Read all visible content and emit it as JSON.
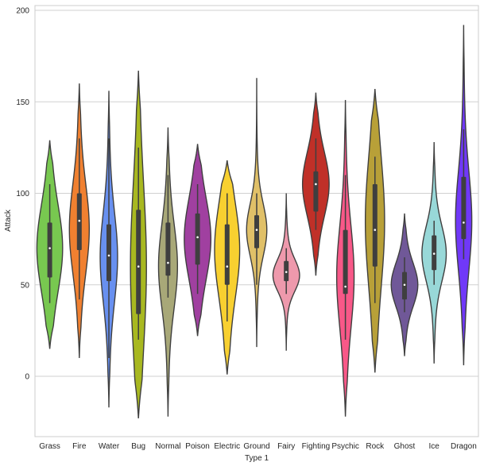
{
  "chart_data": {
    "type": "violin",
    "title": "",
    "xlabel": "Type 1",
    "ylabel": "Attack",
    "ylim": [
      -32,
      202
    ],
    "yticks": [
      0,
      50,
      100,
      150,
      200
    ],
    "grid": true,
    "categories": [
      "Grass",
      "Fire",
      "Water",
      "Bug",
      "Normal",
      "Poison",
      "Electric",
      "Ground",
      "Fairy",
      "Fighting",
      "Psychic",
      "Rock",
      "Ghost",
      "Ice",
      "Dragon"
    ],
    "colors": [
      "#78c850",
      "#f08030",
      "#6890f0",
      "#a8b820",
      "#a8a878",
      "#a040a0",
      "#f8d030",
      "#e0c068",
      "#ee99ac",
      "#c03028",
      "#f85888",
      "#b8a038",
      "#705898",
      "#98d8d8",
      "#7038f8"
    ],
    "series": [
      {
        "name": "Grass",
        "kde_min": 15,
        "kde_max": 129,
        "whisker_low": 40,
        "q1": 54,
        "median": 70,
        "q3": 84,
        "whisker_high": 105,
        "peak": 70
      },
      {
        "name": "Fire",
        "kde_min": 10,
        "kde_max": 160,
        "whisker_low": 42,
        "q1": 69,
        "median": 85,
        "q3": 100,
        "whisker_high": 130,
        "peak": 80
      },
      {
        "name": "Water",
        "kde_min": -17,
        "kde_max": 156,
        "whisker_low": 10,
        "q1": 52,
        "median": 66,
        "q3": 83,
        "whisker_high": 130,
        "peak": 65
      },
      {
        "name": "Bug",
        "kde_min": -23,
        "kde_max": 167,
        "whisker_low": 20,
        "q1": 34,
        "median": 60,
        "q3": 91,
        "whisker_high": 125,
        "peak": 60
      },
      {
        "name": "Normal",
        "kde_min": -22,
        "kde_max": 136,
        "whisker_low": 43,
        "q1": 55,
        "median": 62,
        "q3": 84,
        "whisker_high": 110,
        "peak": 60
      },
      {
        "name": "Poison",
        "kde_min": 22,
        "kde_max": 127,
        "whisker_low": 45,
        "q1": 61,
        "median": 76,
        "q3": 89,
        "whisker_high": 105,
        "peak": 75
      },
      {
        "name": "Electric",
        "kde_min": 1,
        "kde_max": 118,
        "whisker_low": 30,
        "q1": 50,
        "median": 60,
        "q3": 83,
        "whisker_high": 100,
        "peak": 70
      },
      {
        "name": "Ground",
        "kde_min": 16,
        "kde_max": 163,
        "whisker_low": 50,
        "q1": 70,
        "median": 80,
        "q3": 88,
        "whisker_high": 100,
        "peak": 80
      },
      {
        "name": "Fairy",
        "kde_min": 14,
        "kde_max": 100,
        "whisker_low": 45,
        "q1": 52,
        "median": 57,
        "q3": 63,
        "whisker_high": 70,
        "peak": 55
      },
      {
        "name": "Fighting",
        "kde_min": 55,
        "kde_max": 155,
        "whisker_low": 80,
        "q1": 90,
        "median": 105,
        "q3": 112,
        "whisker_high": 130,
        "peak": 105
      },
      {
        "name": "Psychic",
        "kde_min": -22,
        "kde_max": 151,
        "whisker_low": 20,
        "q1": 45,
        "median": 49,
        "q3": 80,
        "whisker_high": 110,
        "peak": 55
      },
      {
        "name": "Rock",
        "kde_min": 2,
        "kde_max": 157,
        "whisker_low": 40,
        "q1": 60,
        "median": 80,
        "q3": 105,
        "whisker_high": 120,
        "peak": 85
      },
      {
        "name": "Ghost",
        "kde_min": 11,
        "kde_max": 89,
        "whisker_low": 35,
        "q1": 42,
        "median": 50,
        "q3": 57,
        "whisker_high": 65,
        "peak": 50
      },
      {
        "name": "Ice",
        "kde_min": 7,
        "kde_max": 128,
        "whisker_low": 50,
        "q1": 58,
        "median": 67,
        "q3": 77,
        "whisker_high": 85,
        "peak": 67
      },
      {
        "name": "Dragon",
        "kde_min": 6,
        "kde_max": 192,
        "whisker_low": 64,
        "q1": 75,
        "median": 84,
        "q3": 109,
        "whisker_high": 135,
        "peak": 85
      }
    ]
  }
}
